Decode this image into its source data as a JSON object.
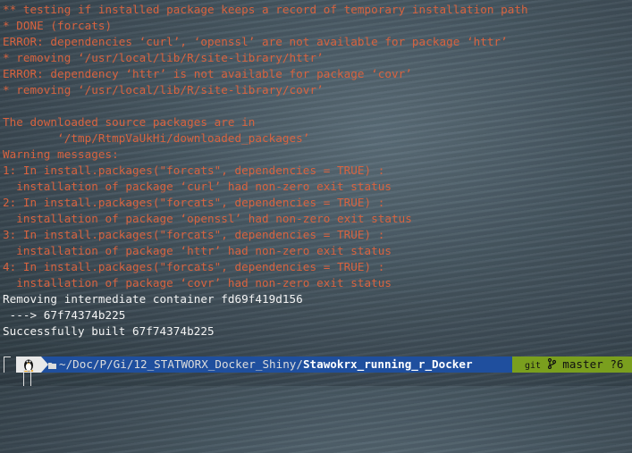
{
  "terminal": {
    "lines": [
      {
        "text": "** testing if installed package keeps a record of temporary installation path",
        "style": "err"
      },
      {
        "text": "* DONE (forcats)",
        "style": "err"
      },
      {
        "text": "ERROR: dependencies ‘curl’, ‘openssl’ are not available for package ‘httr’",
        "style": "err"
      },
      {
        "text": "* removing ‘/usr/local/lib/R/site-library/httr’",
        "style": "err"
      },
      {
        "text": "ERROR: dependency ‘httr’ is not available for package ‘covr’",
        "style": "err"
      },
      {
        "text": "* removing ‘/usr/local/lib/R/site-library/covr’",
        "style": "err"
      },
      {
        "text": "",
        "style": "err"
      },
      {
        "text": "The downloaded source packages are in",
        "style": "err"
      },
      {
        "text": "        ‘/tmp/RtmpVaUkHi/downloaded_packages’",
        "style": "err"
      },
      {
        "text": "Warning messages:",
        "style": "err"
      },
      {
        "text": "1: In install.packages(\"forcats\", dependencies = TRUE) :",
        "style": "err"
      },
      {
        "text": "  installation of package ‘curl’ had non-zero exit status",
        "style": "err"
      },
      {
        "text": "2: In install.packages(\"forcats\", dependencies = TRUE) :",
        "style": "err"
      },
      {
        "text": "  installation of package ‘openssl’ had non-zero exit status",
        "style": "err"
      },
      {
        "text": "3: In install.packages(\"forcats\", dependencies = TRUE) :",
        "style": "err"
      },
      {
        "text": "  installation of package ‘httr’ had non-zero exit status",
        "style": "err"
      },
      {
        "text": "4: In install.packages(\"forcats\", dependencies = TRUE) :",
        "style": "err"
      },
      {
        "text": "  installation of package ‘covr’ had non-zero exit status",
        "style": "err"
      },
      {
        "text": "Removing intermediate container fd69f419d156",
        "style": "out"
      },
      {
        "text": " ---> 67f74374b225",
        "style": "out"
      },
      {
        "text": "Successfully built 67f74374b225",
        "style": "out"
      }
    ]
  },
  "prompt": {
    "os_icon": "linux-tux-icon",
    "folder_icon": "folder-icon",
    "path_prefix": "~/Doc/P/Gi/12_STATWORX_Docker_Shiny/",
    "path_current": "Stawokrx_running_r_Docker",
    "git_icon": "git-icon",
    "branch_icon": "branch-icon",
    "git_label": "git",
    "branch": "master",
    "status": "?6"
  },
  "colors": {
    "error_text": "#d8633f",
    "normal_text": "#f3f3f3",
    "dir_segment": "#1f4f9e",
    "git_segment": "#7a9f1e"
  }
}
